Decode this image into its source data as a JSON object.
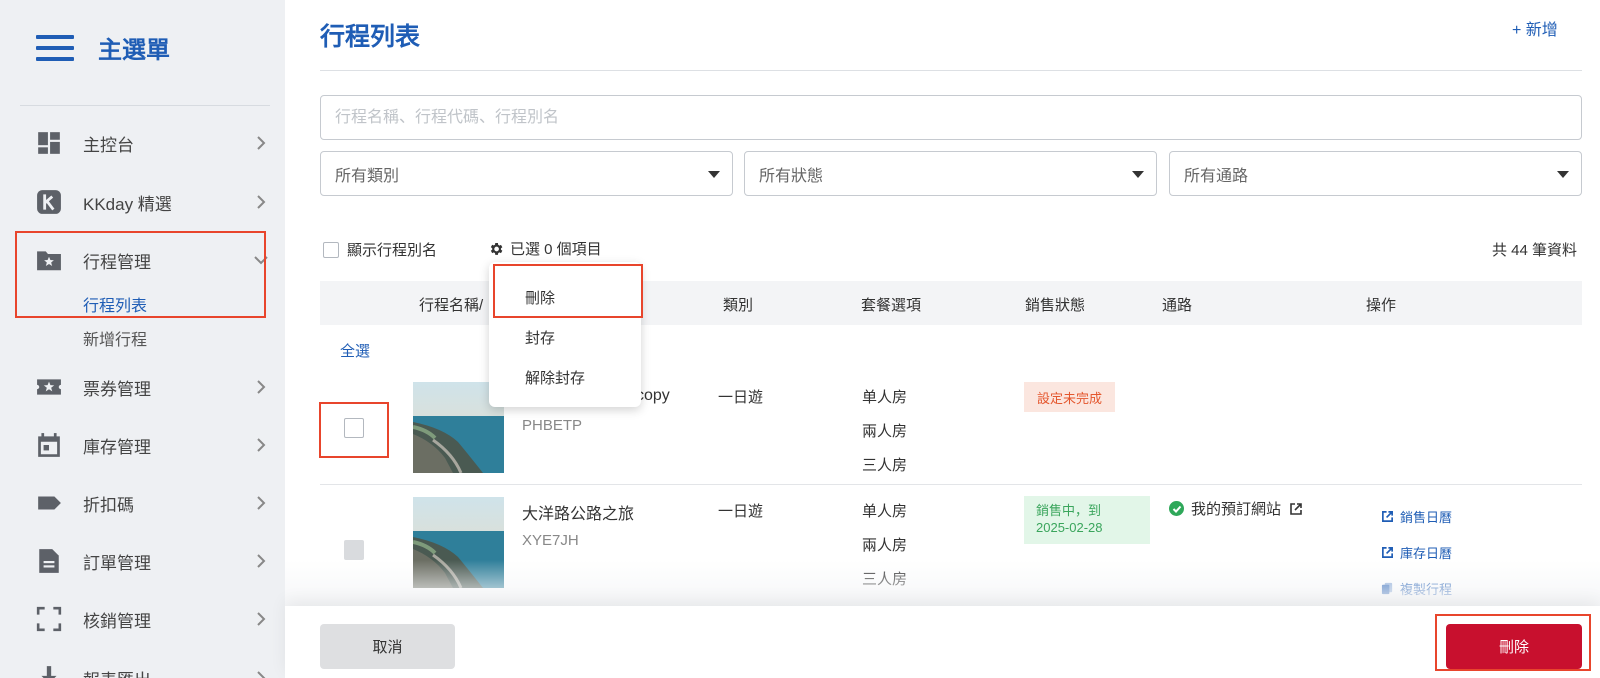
{
  "sidebar": {
    "title": "主選單",
    "items": [
      {
        "label": "主控台",
        "icon": "dashboard-icon"
      },
      {
        "label": "KKday 精選",
        "icon": "kkday-logo-icon"
      },
      {
        "label": "行程管理",
        "icon": "folder-star-icon"
      },
      {
        "label": "票券管理",
        "icon": "ticket-star-icon"
      },
      {
        "label": "庫存管理",
        "icon": "calendar-icon"
      },
      {
        "label": "折扣碼",
        "icon": "tag-icon"
      },
      {
        "label": "訂單管理",
        "icon": "document-icon"
      },
      {
        "label": "核銷管理",
        "icon": "scan-icon"
      },
      {
        "label": "報表匯出",
        "icon": "download-icon"
      }
    ],
    "subitems": [
      {
        "label": "行程列表"
      },
      {
        "label": "新增行程"
      }
    ]
  },
  "header": {
    "title": "行程列表",
    "add_label": "+ 新增"
  },
  "filters": {
    "search_placeholder": "行程名稱、行程代碼、行程別名",
    "category": "所有類別",
    "status": "所有狀態",
    "channel": "所有通路"
  },
  "toolbar": {
    "show_alias_label": "顯示行程別名",
    "selected_label": "已選 0 個項目",
    "total_label": "共 44 筆資料"
  },
  "dropdown": {
    "items": [
      "刪除",
      "封存",
      "解除封存"
    ]
  },
  "table": {
    "headers": [
      "行程名稱/",
      "類別",
      "套餐選項",
      "銷售狀態",
      "通路",
      "操作"
    ],
    "select_all": "全選",
    "rows": [
      {
        "name": "copy",
        "code": "PHBETP",
        "category": "一日遊",
        "options": [
          "单人房",
          "兩人房",
          "三人房"
        ],
        "status": "設定未完成",
        "channel": "",
        "actions": []
      },
      {
        "name": "大洋路公路之旅",
        "code": "XYE7JH",
        "category": "一日遊",
        "options": [
          "单人房",
          "兩人房",
          "三人房"
        ],
        "status": "銷售中，到 2025-02-28",
        "status_line1": "銷售中，到",
        "status_line2": "2025-02-28",
        "channel": "我的預訂網站",
        "actions": [
          "銷售日曆",
          "庫存日曆",
          "複製行程"
        ]
      }
    ]
  },
  "footer": {
    "cancel_label": "取消",
    "delete_label": "刪除"
  },
  "colors": {
    "brand_blue": "#1f5db5",
    "delete_red": "#c8102e",
    "highlight": "#e8452c",
    "status_warn": "#e4572e",
    "status_ok": "#3aa55c"
  }
}
